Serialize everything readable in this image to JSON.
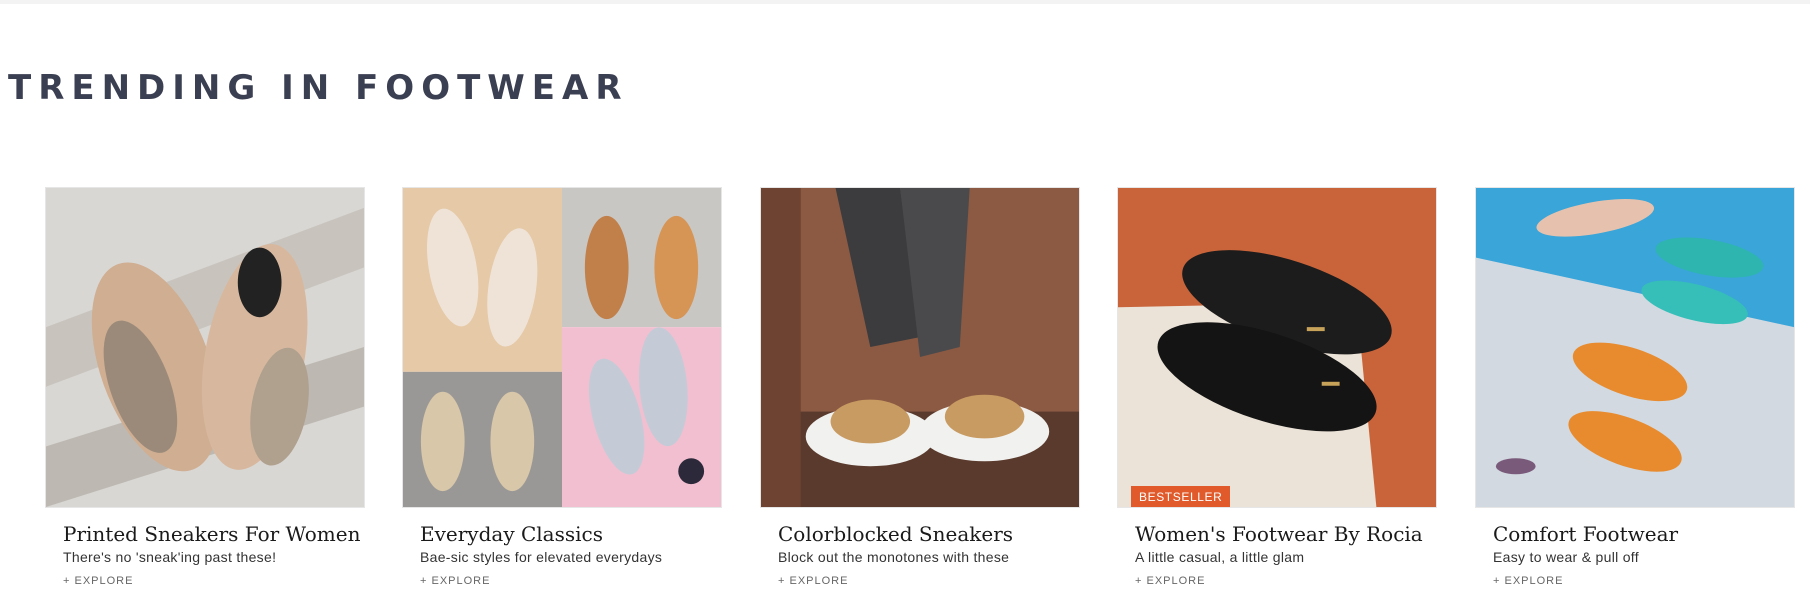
{
  "section": {
    "title": "TRENDING IN FOOTWEAR"
  },
  "cards": [
    {
      "title": "Printed Sneakers For Women",
      "subtitle": "There's no 'sneak'ing past these!",
      "cta": "+ EXPLORE",
      "image_alt": "Printed sneakers photo",
      "badge": ""
    },
    {
      "title": "Everyday Classics",
      "subtitle": "Bae-sic styles for elevated everydays",
      "cta": "+ EXPLORE",
      "image_alt": "Sandals and flip-flops collage",
      "badge": ""
    },
    {
      "title": "Colorblocked Sneakers",
      "subtitle": "Block out the monotones with these",
      "cta": "+ EXPLORE",
      "image_alt": "Colorblocked sneakers photo",
      "badge": ""
    },
    {
      "title": "Women's Footwear By Rocia",
      "subtitle": "A little casual, a little glam",
      "cta": "+ EXPLORE",
      "image_alt": "Black loafers photo",
      "badge": "BESTSELLER"
    },
    {
      "title": "Comfort Footwear",
      "subtitle": "Easy to wear & pull off",
      "cta": "+ EXPLORE",
      "image_alt": "Comfort flats photo",
      "badge": ""
    }
  ],
  "colors": {
    "title": "#3a3f51",
    "badge": "#e05a2b"
  }
}
